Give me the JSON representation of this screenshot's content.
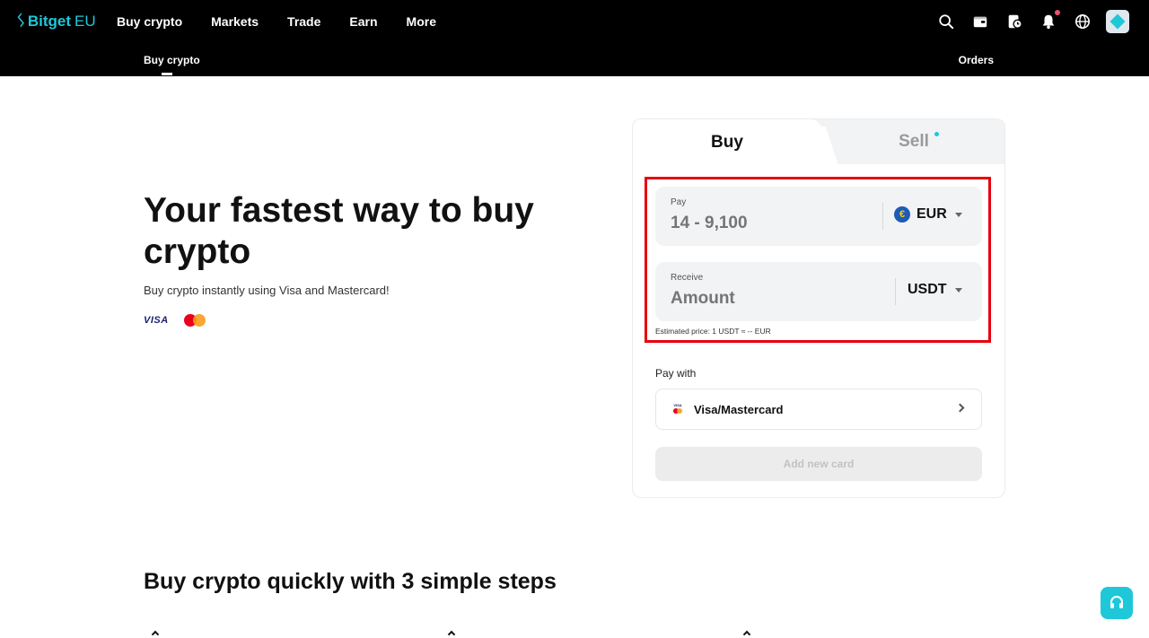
{
  "brand": {
    "logo_text": "Bitget",
    "region": "EU"
  },
  "nav": {
    "items": [
      "Buy crypto",
      "Markets",
      "Trade",
      "Earn",
      "More"
    ]
  },
  "top_icons": [
    "search-icon",
    "wallet-icon",
    "orders-history-icon",
    "bell-icon",
    "globe-icon",
    "avatar"
  ],
  "subnav": {
    "active": "Buy crypto",
    "right": "Orders"
  },
  "hero": {
    "title": "Your fastest way to buy crypto",
    "subtitle": "Buy crypto instantly using Visa and Mastercard!",
    "visa_text": "VISA"
  },
  "panel": {
    "tabs": {
      "buy": "Buy",
      "sell": "Sell"
    },
    "pay": {
      "label": "Pay",
      "placeholder": "14 - 9,100",
      "currency": "EUR",
      "currency_symbol": "€"
    },
    "receive": {
      "label": "Receive",
      "placeholder": "Amount",
      "currency": "USDT"
    },
    "estimated": "Estimated price: 1 USDT ≈ -- EUR",
    "pay_with_label": "Pay with",
    "pay_method": "Visa/Mastercard",
    "add_card": "Add new card"
  },
  "steps": {
    "title": "Buy crypto quickly with 3 simple steps"
  },
  "colors": {
    "accent": "#1ec8d8",
    "highlight": "#e8000e",
    "nav_bg": "#000000"
  }
}
